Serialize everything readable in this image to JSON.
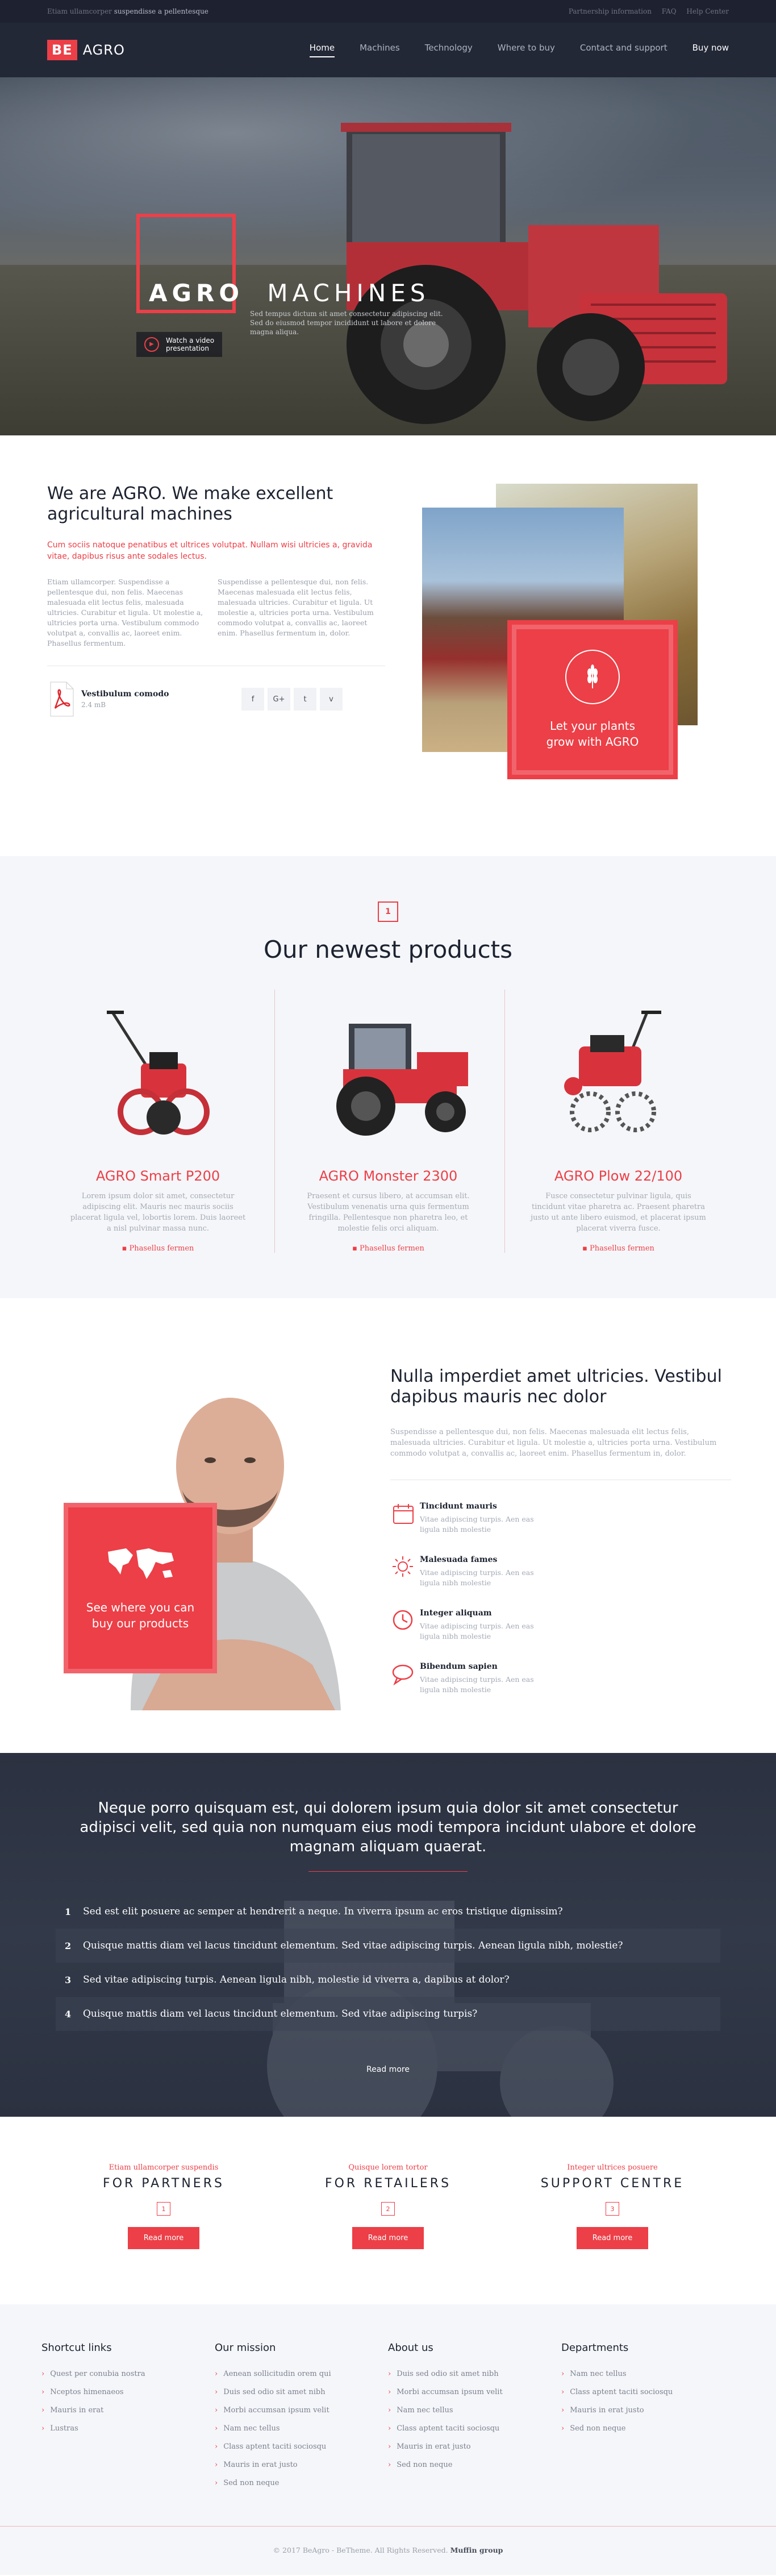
{
  "topbar": {
    "left_plain": "Etiam ullamcorper",
    "left_bold": "suspendisse a pellentesque",
    "links": [
      "Partnership information",
      "FAQ",
      "Help Center"
    ]
  },
  "nav": {
    "logo_badge": "BE",
    "logo_text": "AGRO",
    "items": [
      "Home",
      "Machines",
      "Technology",
      "Where to buy",
      "Contact and support",
      "Buy now"
    ]
  },
  "hero": {
    "title_bold": "AGRO",
    "title_light": "MACHINES",
    "text": "Sed tempus dictum sit amet consectetur adipiscing elit. Sed do eiusmod tempor incididunt ut labore et dolore magna aliqua.",
    "video_label_1": "Watch a video",
    "video_label_2": "presentation"
  },
  "about": {
    "heading": "We are AGRO. We make excellent agricultural machines",
    "lead": "Cum sociis natoque penatibus et ultrices volutpat. Nullam wisi ultricies a, gravida vitae, dapibus risus ante sodales lectus.",
    "col1": "Etiam ullamcorper. Suspendisse a pellentesque dui, non felis. Maecenas malesuada elit lectus felis, malesuada ultricies. Curabitur et ligula. Ut molestie a, ultricies porta urna. Vestibulum commodo volutpat a, convallis ac, laoreet enim. Phasellus fermentum.",
    "col2": "Suspendisse a pellentesque dui, non felis. Maecenas malesuada elit lectus felis, malesuada ultricies. Curabitur et ligula. Ut molestie a, ultricies porta urna. Vestibulum commodo volutpat a, convallis ac, laoreet enim. Phasellus fermentum in, dolor.",
    "file_name": "Vestibulum comodo",
    "file_size": "2.4 mB",
    "social": [
      "f",
      "G+",
      "t",
      "v"
    ],
    "promo": "Let your plants grow with AGRO"
  },
  "products": {
    "icon_label": "1",
    "heading": "Our newest products",
    "items": [
      {
        "name": "AGRO Smart P200",
        "desc": "Lorem ipsum dolor sit amet, consectetur adipiscing elit. Mauris nec mauris sociis placerat ligula vel, lobortis lorem. Duis laoreet a nisl pulvinar massa nunc.",
        "more": "Phasellus fermen"
      },
      {
        "name": "AGRO Monster 2300",
        "desc": "Praesent et cursus libero, at accumsan elit. Vestibulum venenatis urna quis fermentum fringilla. Pellentesque non pharetra leo, et molestie felis orci aliquam.",
        "more": "Phasellus fermen"
      },
      {
        "name": "AGRO Plow 22/100",
        "desc": "Fusce consectetur pulvinar ligula, quis tincidunt vitae pharetra ac. Praesent pharetra justo ut ante libero euismod, et placerat ipsum placerat viverra fusce.",
        "more": "Phasellus fermen"
      }
    ]
  },
  "mission": {
    "heading": "Nulla imperdiet amet ultricies. Vestibul dapibus mauris nec dolor",
    "desc": "Suspendisse a pellentesque dui, non felis. Maecenas malesuada elit lectus felis, malesuada ultricies. Curabitur et ligula. Ut molestie a, ultricies porta urna. Vestibulum commodo volutpat a, convallis ac, laoreet enim. Phasellus fermentum in, dolor.",
    "promo": "See where you can buy our products",
    "features": [
      {
        "title": "Tincidunt mauris",
        "text": "Vitae adipiscing turpis. Aen eas ligula nibh molestie",
        "icon": "calendar-icon"
      },
      {
        "title": "Malesuada fames",
        "text": "Vitae adipiscing turpis. Aen eas ligula nibh molestie",
        "icon": "sun-icon"
      },
      {
        "title": "Integer aliquam",
        "text": "Vitae adipiscing turpis. Aen eas ligula nibh molestie",
        "icon": "clock-icon"
      },
      {
        "title": "Bibendum sapien",
        "text": "Vitae adipiscing turpis. Aen eas ligula nibh molestie",
        "icon": "chat-icon"
      }
    ]
  },
  "faq": {
    "quote": "Neque porro quisquam est, qui dolorem ipsum quia dolor sit amet consectetur adipisci velit, sed quia non numquam eius modi tempora incidunt ulabore et dolore magnam aliquam quaerat.",
    "items": [
      {
        "num": "1",
        "text": "Sed est elit posuere ac semper at hendrerit a neque. In viverra ipsum ac eros tristique dignissim?"
      },
      {
        "num": "2",
        "text": "Quisque mattis diam vel lacus tincidunt elementum. Sed vitae adipiscing turpis. Aenean ligula nibh, molestie?"
      },
      {
        "num": "3",
        "text": "Sed vitae adipiscing turpis. Aenean ligula nibh, molestie id viverra a, dapibus at dolor?"
      },
      {
        "num": "4",
        "text": "Quisque mattis diam vel lacus tincidunt elementum. Sed vitae adipiscing turpis?"
      }
    ],
    "read_more": "Read more"
  },
  "partners": [
    {
      "sub": "Etiam ullamcorper suspendis",
      "title": "FOR PARTNERS",
      "num": "1",
      "button": "Read more"
    },
    {
      "sub": "Quisque lorem tortor",
      "title": "FOR RETAILERS",
      "num": "2",
      "button": "Read more"
    },
    {
      "sub": "Integer ultrices posuere",
      "title": "SUPPORT CENTRE",
      "num": "3",
      "button": "Read more"
    }
  ],
  "footer": {
    "columns": [
      {
        "title": "Shortcut links",
        "items": [
          "Quest per conubia nostra",
          "Nceptos himenaeos",
          "Mauris in erat",
          "Lustras"
        ]
      },
      {
        "title": "Our mission",
        "items": [
          "Aenean sollicitudin orem qui",
          "Duis sed odio sit amet nibh",
          "Morbi accumsan ipsum velit",
          "Nam nec tellus",
          "Class aptent taciti sociosqu",
          "Mauris in erat justo",
          "Sed non neque"
        ]
      },
      {
        "title": "About us",
        "items": [
          "Duis sed odio sit amet nibh",
          "Morbi accumsan ipsum velit",
          "Nam nec tellus",
          "Class aptent taciti sociosqu",
          "Mauris in erat justo",
          "Sed non neque"
        ]
      },
      {
        "title": "Departments",
        "items": [
          "Nam nec tellus",
          "Class aptent taciti sociosqu",
          "Mauris in erat justo",
          "Sed non neque"
        ]
      }
    ],
    "copyright": "© 2017 BeAgro - BeTheme. All Rights Reserved.",
    "brand": "Muffin group"
  },
  "colors": {
    "accent": "#ec3f47",
    "dark": "#232837",
    "light_bg": "#f5f6f9"
  }
}
